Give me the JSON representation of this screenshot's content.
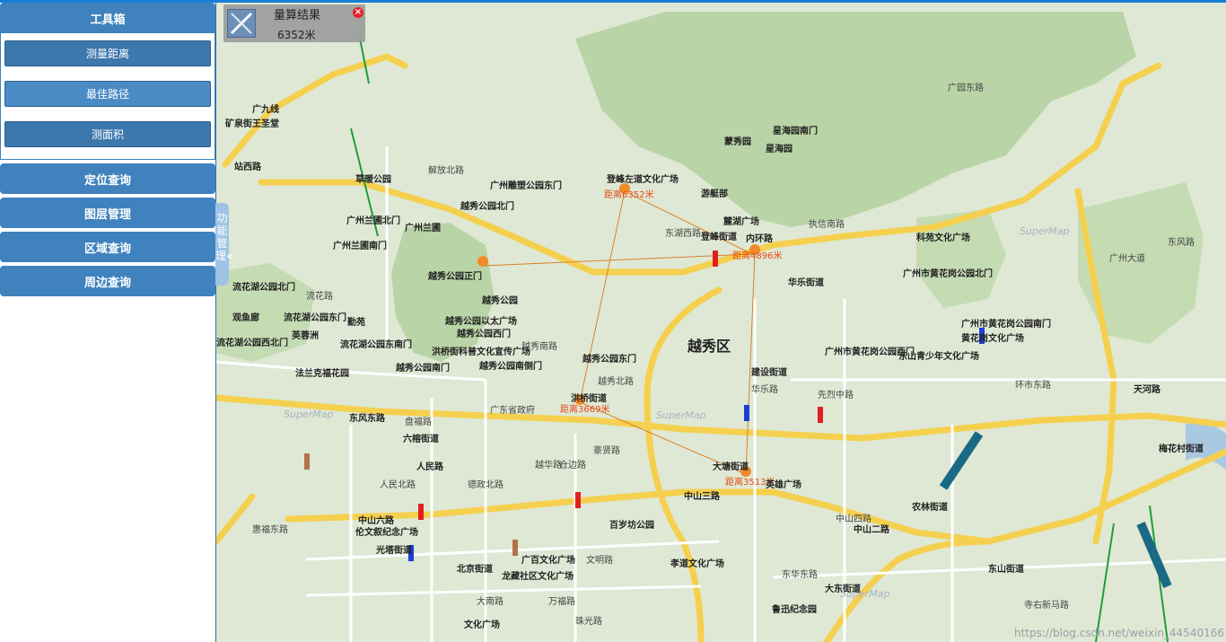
{
  "sidebar": {
    "toolbox_title": "工具箱",
    "tools": [
      "测量距离",
      "最佳路径",
      "测面积"
    ],
    "sections": [
      "定位查询",
      "图层管理",
      "区域查询",
      "周边查询"
    ],
    "collapse_tab": "功能管理«"
  },
  "measure": {
    "title": "量算结果",
    "value": "6352米"
  },
  "map": {
    "district": "越秀区",
    "watermark": "SuperMap",
    "footer_url": "https://blog.csdn.net/weixin_44540166",
    "distances": [
      "距离6352米",
      "距离4896米",
      "距离3513米",
      "距离3669米"
    ],
    "places": [
      "工具箱",
      "矿泉街王圣堂",
      "站西路",
      "广九线",
      "草暖公园",
      "广州兰圃北门",
      "广州兰圃",
      "广州兰圃南门",
      "流花湖公园北门",
      "流花湖公园东门",
      "观鱼廊",
      "勤苑",
      "英蓉洲",
      "流花湖公园东南门",
      "流花湖公园西北门",
      "法兰克福花园",
      "越秀公园北门",
      "越秀公园正门",
      "越秀公园",
      "越秀公园以太广场",
      "越秀公园西门",
      "洪桥街科普文化宣传广场",
      "越秀公园南门",
      "越秀公园南侧门",
      "越秀公园东门",
      "广州雕塑公园东门",
      "登峰左道文化广场",
      "游艇部",
      "蒙秀园",
      "星海园南门",
      "星海园",
      "麓湖广场",
      "登峰街道",
      "内环路",
      "华乐街道",
      "科苑文化广场",
      "广州市黄花岗公园北门",
      "广州市黄花岗公园南门",
      "黄花岗文化广场",
      "广州市黄花岗公园西门",
      "东山青少年文化广场",
      "广东省政府",
      "东风东路",
      "六榕街道",
      "人民路",
      "洪桥街道",
      "大塘街道",
      "英雄广场",
      "中山三路",
      "百岁坊公园",
      "中山二路",
      "农林街道",
      "孝道文化广场",
      "北京街道",
      "龙藏社区文化广场",
      "广百文化广场",
      "伦文叙纪念广场",
      "光塔街道",
      "中山六路",
      "东山街道",
      "鲁迅纪念园",
      "大东街道",
      "文化广场",
      "梅花村街道",
      "天河路",
      "东风路",
      "环市东路",
      "广园东路",
      "广州大道",
      "珠光路",
      "文明路",
      "越华路",
      "惠福东路",
      "寺右新马路",
      "越秀南路",
      "建设街道",
      "华乐路",
      "先烈中路",
      "东湖西路",
      "大南路",
      "万福路",
      "流花路",
      "解放北路",
      "盘福路",
      "人民北路",
      "东华东路",
      "中山四路",
      "执信南路",
      "越秀北路",
      "仓边路",
      "豪贤路",
      "德政北路"
    ]
  }
}
